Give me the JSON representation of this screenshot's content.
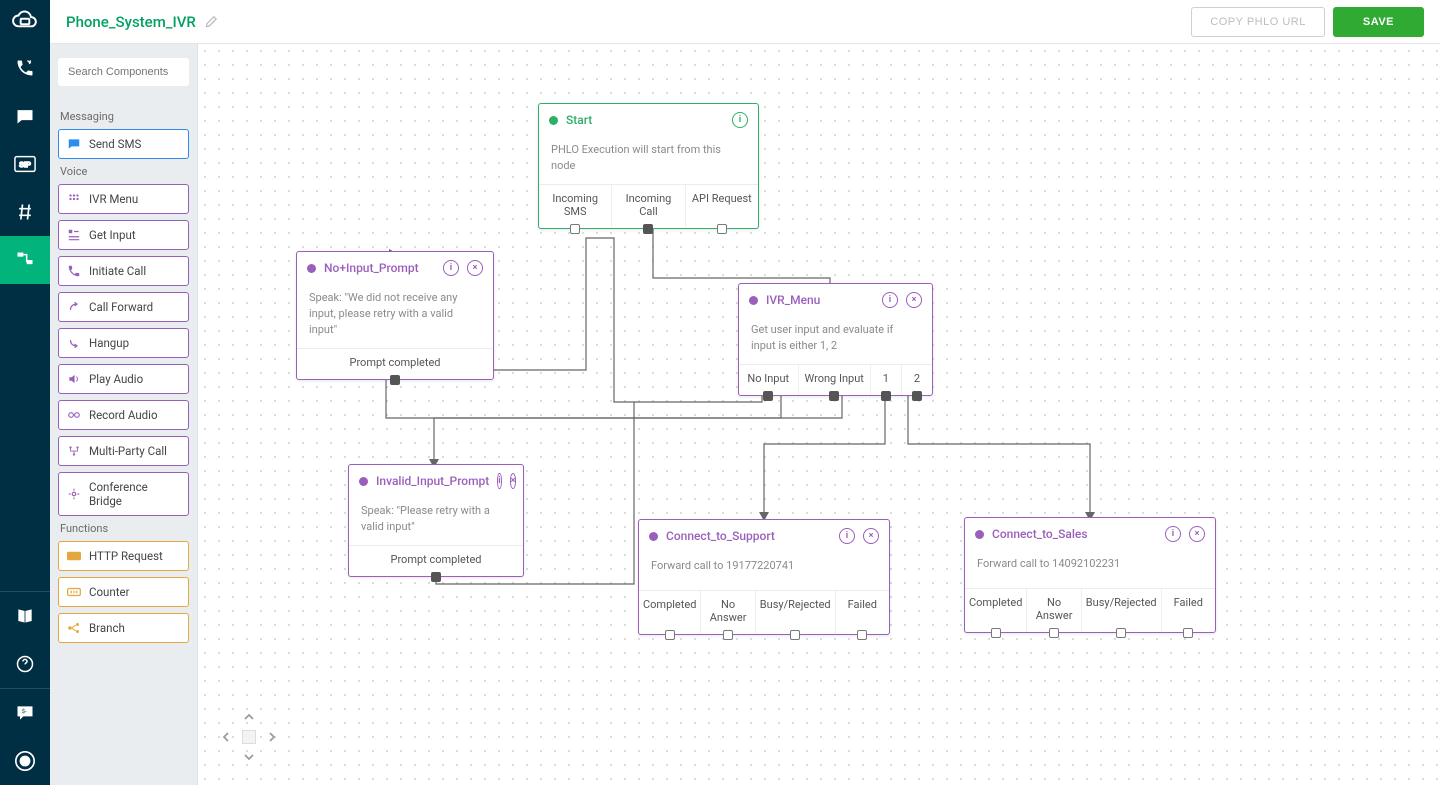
{
  "header": {
    "title": "Phone_System_IVR",
    "copy_label": "COPY PHLO URL",
    "save_label": "SAVE"
  },
  "search": {
    "placeholder": "Search Components"
  },
  "sections": {
    "messaging_label": "Messaging",
    "voice_label": "Voice",
    "functions_label": "Functions"
  },
  "components": {
    "messaging": [
      "Send SMS"
    ],
    "voice": [
      "IVR Menu",
      "Get Input",
      "Initiate Call",
      "Call Forward",
      "Hangup",
      "Play Audio",
      "Record Audio",
      "Multi-Party Call",
      "Conference Bridge"
    ],
    "functions": [
      "HTTP Request",
      "Counter",
      "Branch"
    ]
  },
  "nodes": {
    "start": {
      "title": "Start",
      "desc": "PHLO Execution will start from this node",
      "outputs": [
        "Incoming SMS",
        "Incoming Call",
        "API Request"
      ]
    },
    "no_input": {
      "title": "No+Input_Prompt",
      "desc": "Speak: \"We did not receive any input, please retry with a valid input\"",
      "outputs": [
        "Prompt completed"
      ]
    },
    "ivr_menu": {
      "title": "IVR_Menu",
      "desc": "Get user input and evaluate if input is either 1, 2",
      "outputs": [
        "No Input",
        "Wrong Input",
        "1",
        "2"
      ]
    },
    "invalid": {
      "title": "Invalid_Input_Prompt",
      "desc": "Speak: \"Please retry with a valid input\"",
      "outputs": [
        "Prompt completed"
      ]
    },
    "support": {
      "title": "Connect_to_Support",
      "desc": "Forward call to 19177220741",
      "outputs": [
        "Completed",
        "No Answer",
        "Busy/Rejected",
        "Failed"
      ]
    },
    "sales": {
      "title": "Connect_to_Sales",
      "desc": "Forward call to 14092102231",
      "outputs": [
        "Completed",
        "No Answer",
        "Busy/Rejected",
        "Failed"
      ]
    }
  }
}
